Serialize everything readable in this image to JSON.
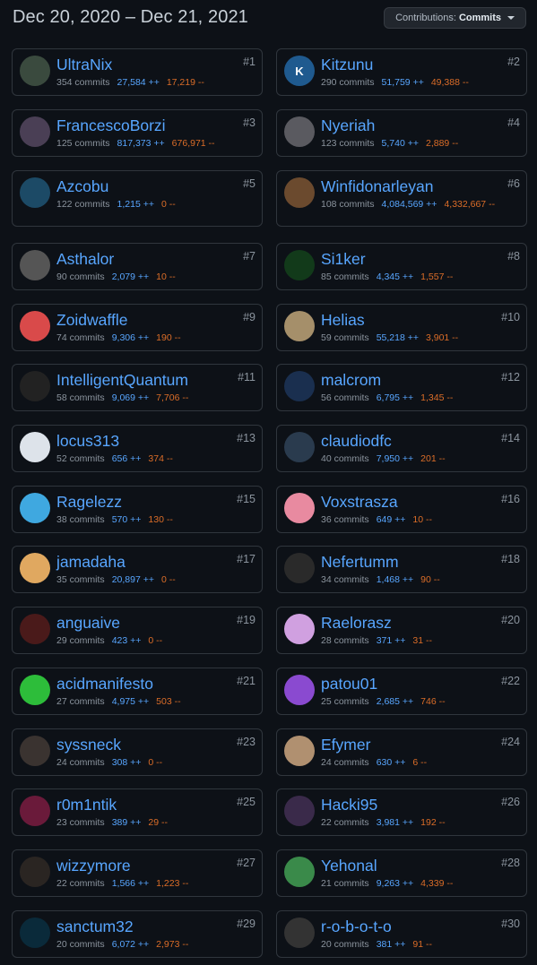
{
  "date_range": "Dec 20, 2020 – Dec 21, 2021",
  "contributions_dropdown": {
    "label": "Contributions:",
    "value": "Commits"
  },
  "contributors": [
    {
      "rank": "#1",
      "name": "UltraNix",
      "commits": "354 commits",
      "additions": "27,584 ++",
      "deletions": "17,219 --",
      "avatar_color": "#3a4a3e",
      "avatar_text": ""
    },
    {
      "rank": "#2",
      "name": "Kitzunu",
      "commits": "290 commits",
      "additions": "51,759 ++",
      "deletions": "49,388 --",
      "avatar_color": "#1f5a8f",
      "avatar_text": "K"
    },
    {
      "rank": "#3",
      "name": "FrancescoBorzi",
      "commits": "125 commits",
      "additions": "817,373 ++",
      "deletions": "676,971 --",
      "avatar_color": "#4a3f55",
      "avatar_text": ""
    },
    {
      "rank": "#4",
      "name": "Nyeriah",
      "commits": "123 commits",
      "additions": "5,740 ++",
      "deletions": "2,889 --",
      "avatar_color": "#5a5a60",
      "avatar_text": ""
    },
    {
      "rank": "#5",
      "name": "Azcobu",
      "commits": "122 commits",
      "additions": "1,215 ++",
      "deletions": "0 --",
      "avatar_color": "#1c4a66",
      "avatar_text": ""
    },
    {
      "rank": "#6",
      "name": "Winfidonarleyan",
      "commits": "108 commits",
      "additions": "4,084,569 ++",
      "deletions": "4,332,667 --",
      "avatar_color": "#6b4a2e",
      "avatar_text": ""
    },
    {
      "rank": "#7",
      "name": "Asthalor",
      "commits": "90 commits",
      "additions": "2,079 ++",
      "deletions": "10 --",
      "avatar_color": "#555",
      "avatar_text": ""
    },
    {
      "rank": "#8",
      "name": "Si1ker",
      "commits": "85 commits",
      "additions": "4,345 ++",
      "deletions": "1,557 --",
      "avatar_color": "#123a1a",
      "avatar_text": ""
    },
    {
      "rank": "#9",
      "name": "Zoidwaffle",
      "commits": "74 commits",
      "additions": "9,306 ++",
      "deletions": "190 --",
      "avatar_color": "#d94a4a",
      "avatar_text": ""
    },
    {
      "rank": "#10",
      "name": "Helias",
      "commits": "59 commits",
      "additions": "55,218 ++",
      "deletions": "3,901 --",
      "avatar_color": "#a58f6a",
      "avatar_text": ""
    },
    {
      "rank": "#11",
      "name": "IntelligentQuantum",
      "commits": "58 commits",
      "additions": "9,069 ++",
      "deletions": "7,706 --",
      "avatar_color": "#222",
      "avatar_text": ""
    },
    {
      "rank": "#12",
      "name": "malcrom",
      "commits": "56 commits",
      "additions": "6,795 ++",
      "deletions": "1,345 --",
      "avatar_color": "#1a2f4f",
      "avatar_text": ""
    },
    {
      "rank": "#13",
      "name": "locus313",
      "commits": "52 commits",
      "additions": "656 ++",
      "deletions": "374 --",
      "avatar_color": "#dde3ea",
      "avatar_text": ""
    },
    {
      "rank": "#14",
      "name": "claudiodfc",
      "commits": "40 commits",
      "additions": "7,950 ++",
      "deletions": "201 --",
      "avatar_color": "#2a3b4e",
      "avatar_text": ""
    },
    {
      "rank": "#15",
      "name": "Ragelezz",
      "commits": "38 commits",
      "additions": "570 ++",
      "deletions": "130 --",
      "avatar_color": "#3fa8e0",
      "avatar_text": ""
    },
    {
      "rank": "#16",
      "name": "Voxstrasza",
      "commits": "36 commits",
      "additions": "649 ++",
      "deletions": "10 --",
      "avatar_color": "#e88aa0",
      "avatar_text": ""
    },
    {
      "rank": "#17",
      "name": "jamadaha",
      "commits": "35 commits",
      "additions": "20,897 ++",
      "deletions": "0 --",
      "avatar_color": "#e0a860",
      "avatar_text": ""
    },
    {
      "rank": "#18",
      "name": "Nefertumm",
      "commits": "34 commits",
      "additions": "1,468 ++",
      "deletions": "90 --",
      "avatar_color": "#2a2a2a",
      "avatar_text": ""
    },
    {
      "rank": "#19",
      "name": "anguaive",
      "commits": "29 commits",
      "additions": "423 ++",
      "deletions": "0 --",
      "avatar_color": "#4a1a1a",
      "avatar_text": ""
    },
    {
      "rank": "#20",
      "name": "Raelorasz",
      "commits": "28 commits",
      "additions": "371 ++",
      "deletions": "31 --",
      "avatar_color": "#d0a0e0",
      "avatar_text": ""
    },
    {
      "rank": "#21",
      "name": "acidmanifesto",
      "commits": "27 commits",
      "additions": "4,975 ++",
      "deletions": "503 --",
      "avatar_color": "#2dbd3a",
      "avatar_text": ""
    },
    {
      "rank": "#22",
      "name": "patou01",
      "commits": "25 commits",
      "additions": "2,685 ++",
      "deletions": "746 --",
      "avatar_color": "#8a4ad0",
      "avatar_text": ""
    },
    {
      "rank": "#23",
      "name": "syssneck",
      "commits": "24 commits",
      "additions": "308 ++",
      "deletions": "0 --",
      "avatar_color": "#3a3330",
      "avatar_text": ""
    },
    {
      "rank": "#24",
      "name": "Efymer",
      "commits": "24 commits",
      "additions": "630 ++",
      "deletions": "6 --",
      "avatar_color": "#b09070",
      "avatar_text": ""
    },
    {
      "rank": "#25",
      "name": "r0m1ntik",
      "commits": "23 commits",
      "additions": "389 ++",
      "deletions": "29 --",
      "avatar_color": "#6a1a3a",
      "avatar_text": ""
    },
    {
      "rank": "#26",
      "name": "Hacki95",
      "commits": "22 commits",
      "additions": "3,981 ++",
      "deletions": "192 --",
      "avatar_color": "#3a2a4a",
      "avatar_text": ""
    },
    {
      "rank": "#27",
      "name": "wizzymore",
      "commits": "22 commits",
      "additions": "1,566 ++",
      "deletions": "1,223 --",
      "avatar_color": "#2a2522",
      "avatar_text": ""
    },
    {
      "rank": "#28",
      "name": "Yehonal",
      "commits": "21 commits",
      "additions": "9,263 ++",
      "deletions": "4,339 --",
      "avatar_color": "#3a8a4a",
      "avatar_text": ""
    },
    {
      "rank": "#29",
      "name": "sanctum32",
      "commits": "20 commits",
      "additions": "6,072 ++",
      "deletions": "2,973 --",
      "avatar_color": "#0a2a3a",
      "avatar_text": ""
    },
    {
      "rank": "#30",
      "name": "r-o-b-o-t-o",
      "commits": "20 commits",
      "additions": "381 ++",
      "deletions": "91 --",
      "avatar_color": "#333",
      "avatar_text": ""
    }
  ]
}
